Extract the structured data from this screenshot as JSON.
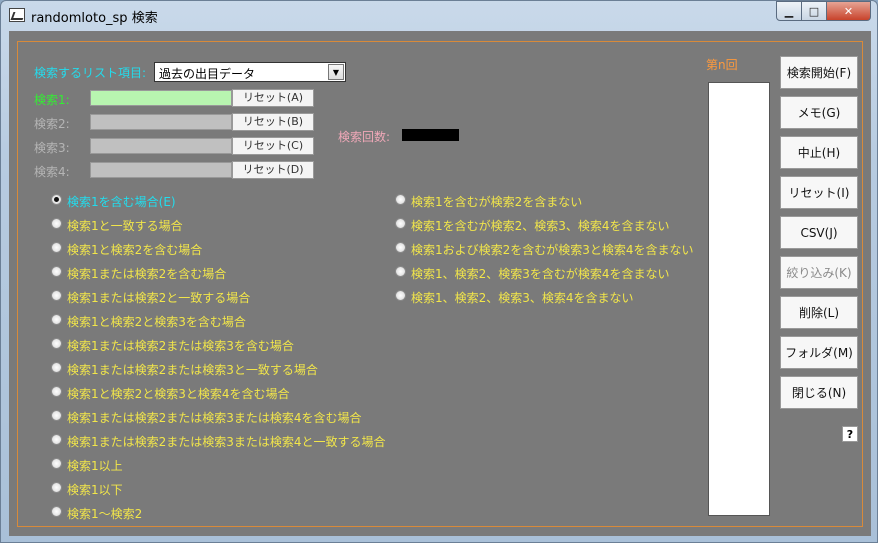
{
  "window": {
    "title": "randomloto_sp  検索",
    "min_glyph": "▁",
    "max_glyph": "□",
    "close_glyph": "✕"
  },
  "search": {
    "list_item_label": "検索するリスト項目:",
    "list_item_value": "過去の出目データ",
    "dropdown_glyph": "▼",
    "fields": [
      {
        "label": "検索1:",
        "reset_label": "リセット(A)",
        "value": ""
      },
      {
        "label": "検索2:",
        "reset_label": "リセット(B)",
        "value": ""
      },
      {
        "label": "検索3:",
        "reset_label": "リセット(C)",
        "value": ""
      },
      {
        "label": "検索4:",
        "reset_label": "リセット(D)",
        "value": ""
      }
    ],
    "count_label": "検索回数:",
    "count_value": ""
  },
  "options_left": [
    "検索1を含む場合(E)",
    "検索1と一致する場合",
    "検索1と検索2を含む場合",
    "検索1または検索2を含む場合",
    "検索1または検索2と一致する場合",
    "検索1と検索2と検索3を含む場合",
    "検索1または検索2または検索3を含む場合",
    "検索1または検索2または検索3と一致する場合",
    "検索1と検索2と検索3と検索4を含む場合",
    "検索1または検索2または検索3または検索4を含む場合",
    "検索1または検索2または検索3または検索4と一致する場合",
    "検索1以上",
    "検索1以下",
    "検索1～検索2"
  ],
  "options_right": [
    "検索1を含むが検索2を含まない",
    "検索1を含むが検索2、検索3、検索4を含まない",
    "検索1および検索2を含むが検索3と検索4を含まない",
    "検索1、検索2、検索3を含むが検索4を含まない",
    "検索1、検索2、検索3、検索4を含まない"
  ],
  "selected_option": "検索1を含む場合(E)",
  "results": {
    "header": "第n回"
  },
  "buttons": {
    "start": "検索開始(F)",
    "memo": "メモ(G)",
    "stop": "中止(H)",
    "reset": "リセット(I)",
    "csv": "CSV(J)",
    "filter": "絞り込み(K)",
    "delete": "削除(L)",
    "folder": "フォルダ(M)",
    "close": "閉じる(N)",
    "help": "?"
  },
  "colors": {
    "background": "#7a7a7a",
    "frame": "#d88a3a",
    "active_label": "#33ee33",
    "selected_option": "#22ddee",
    "option_text": "#f2e64a",
    "results_header": "#ff9a3c"
  }
}
